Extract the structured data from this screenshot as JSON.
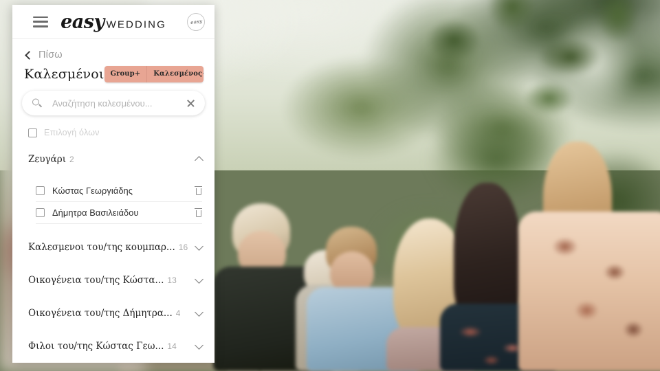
{
  "app": {
    "brand_script": "easy",
    "brand_caps": "WEDDING",
    "logo_badge_text": "easy",
    "menu_icon": "hamburger-menu-icon"
  },
  "nav": {
    "back_label": "Πίσω",
    "back_icon": "chevron-left-icon"
  },
  "header": {
    "page_title": "Καλεσμένοι",
    "actions": [
      {
        "label": "Group+",
        "name": "add-group-button"
      },
      {
        "label": "Καλεσμένος+",
        "name": "add-guest-button"
      }
    ],
    "accent_color": "#e8a593"
  },
  "search": {
    "placeholder": "Αναζήτηση καλεσμένου...",
    "value": "",
    "icon": "search-icon",
    "clear_icon": "close-icon"
  },
  "select_all": {
    "label": "Επιλογή όλων",
    "checked": false
  },
  "groups": [
    {
      "name": "Ζευγάρι",
      "count": "2",
      "expanded": true,
      "chevron": "chevron-up-icon",
      "guests": [
        {
          "name": "Κώστας Γεωργιάδης",
          "checked": false
        },
        {
          "name": "Δήμητρα Βασιλειάδου",
          "checked": false
        }
      ]
    },
    {
      "name": "Καλεσμενοι του/της κουμπαρ...",
      "count": "16",
      "expanded": false,
      "chevron": "chevron-down-icon",
      "guests": []
    },
    {
      "name": "Οικογένεια του/της Κώστα...",
      "count": "13",
      "expanded": false,
      "chevron": "chevron-down-icon",
      "guests": []
    },
    {
      "name": "Οικογένεια του/της Δήμητρα...",
      "count": "4",
      "expanded": false,
      "chevron": "chevron-down-icon",
      "guests": []
    },
    {
      "name": "Φιλοι του/της Κώστας Γεω...",
      "count": "14",
      "expanded": false,
      "chevron": "chevron-down-icon",
      "guests": []
    }
  ],
  "background": {
    "description": "Blurred outdoor wedding ceremony photo: guests seen from behind, evergreen trees, overcast bright sky",
    "sky_color": "#e6e9de",
    "foliage_color": "#4b6433",
    "ground_color": "#b3aa92"
  }
}
